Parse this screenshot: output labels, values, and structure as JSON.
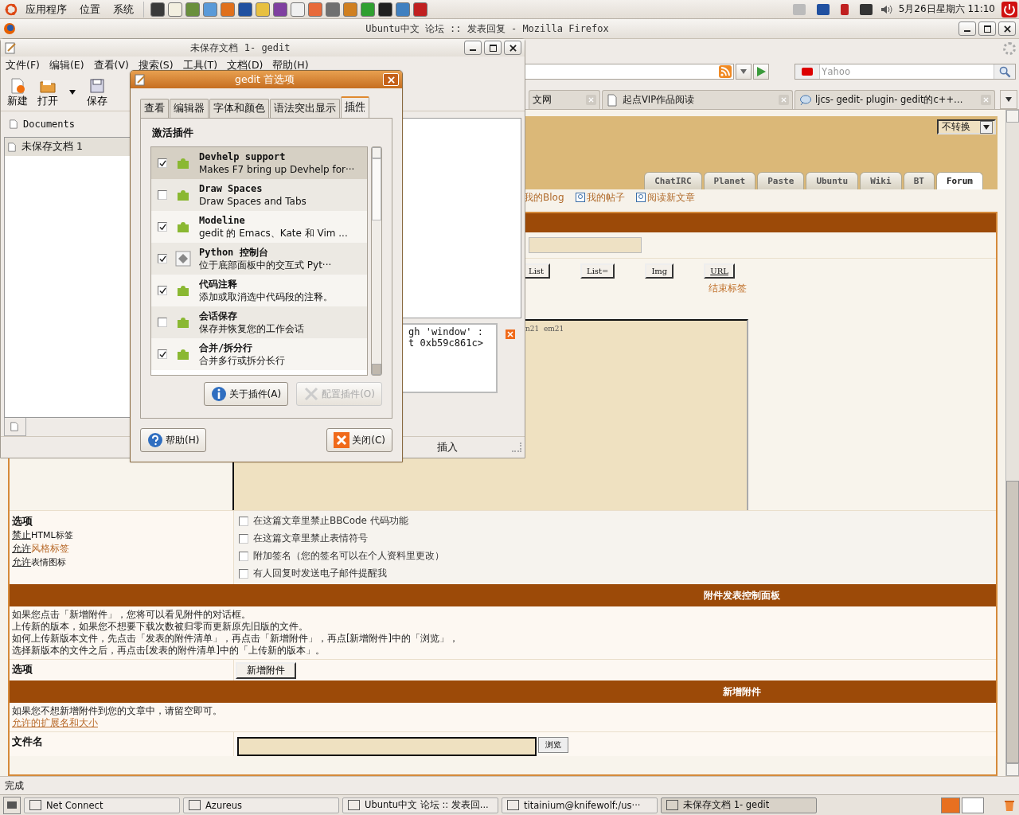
{
  "top_panel": {
    "menus": [
      "应用程序",
      "位置",
      "系统"
    ],
    "clock": "5月26日星期六 11:10"
  },
  "firefox": {
    "title": "Ubuntu中文 论坛 :: 发表回复 - Mozilla Firefox",
    "search": {
      "placeholder": "Yahoo"
    },
    "tabs": [
      {
        "label": "文网",
        "selected": false
      },
      {
        "label": "起点VIP作品阅读",
        "selected": false
      },
      {
        "label": "ljcs- gedit- plugin- gedit的c++…",
        "selected": false
      }
    ],
    "page": {
      "encoding_select": "不转换",
      "site_tabs": [
        {
          "label": "ChatIRC",
          "selected": false
        },
        {
          "label": "Planet",
          "selected": false
        },
        {
          "label": "Paste",
          "selected": false
        },
        {
          "label": "Ubuntu",
          "selected": false
        },
        {
          "label": "Wiki",
          "selected": false
        },
        {
          "label": "BT",
          "selected": false
        },
        {
          "label": "Forum",
          "selected": true
        }
      ],
      "user_links": [
        "我的Blog",
        "我的帖子",
        "阅读新文章"
      ],
      "bbcode_buttons": [
        "List",
        "List=",
        "Img",
        "URL"
      ],
      "close_tags_link": "结束标签",
      "message_text": "n21  em21",
      "options": {
        "heading": "选项",
        "rules": [
          {
            "state": "禁止",
            "rest": "HTML标签",
            "link": false
          },
          {
            "state": "允许",
            "rest": "风格标签",
            "link": true
          },
          {
            "state": "允许",
            "rest": "表情图标",
            "link": false
          }
        ],
        "checkboxes": [
          {
            "label": "在这篇文章里禁止BBCode 代码功能",
            "checked": false
          },
          {
            "label": "在这篇文章里禁止表情符号",
            "checked": false
          },
          {
            "label": "附加签名（您的签名可以在个人资料里更改）",
            "checked": false
          },
          {
            "label": "有人回复时发送电子邮件提醒我",
            "checked": false
          }
        ]
      },
      "attach_panel": {
        "title": "附件发表控制面板",
        "lines": [
          "如果您点击「新增附件」，您将可以看见附件的对话框。",
          "上传新的版本，如果您不想要下载次数被归零而更新原先旧版的文件。",
          "如何上传新版本文件，先点击「发表的附件清单」，再点击「新增附件」，再点[新增附件]中的「浏览」，",
          "选择新版本的文件之后，再点击[发表的附件清单]中的「上传新的版本」。"
        ],
        "option_label": "选项",
        "add_button": "新增附件"
      },
      "new_attach": {
        "title": "新增附件",
        "hint": "如果您不想新增附件到您的文章中，请留空即可。",
        "link": "允许的扩展名和大小",
        "file_label": "文件名",
        "browse": "浏览"
      }
    },
    "status": "完成"
  },
  "gedit": {
    "title": "未保存文档 1- gedit",
    "menus": [
      "文件(F)",
      "编辑(E)",
      "查看(V)",
      "搜索(S)",
      "工具(T)",
      "文档(D)",
      "帮助(H)"
    ],
    "toolbar": [
      {
        "label": "新建",
        "kind": "new"
      },
      {
        "label": "打开",
        "kind": "open"
      },
      {
        "label": "保存",
        "kind": "save"
      }
    ],
    "side_header": "Documents",
    "documents": [
      {
        "label": "未保存文档 1",
        "selected": true
      }
    ],
    "console_lines": [
      "gh 'window' :",
      "t 0xb59c861c>"
    ],
    "status": "插入"
  },
  "prefs": {
    "title": "gedit 首选项",
    "tabs": [
      {
        "label": "查看",
        "selected": false
      },
      {
        "label": "编辑器",
        "selected": false
      },
      {
        "label": "字体和颜色",
        "selected": false
      },
      {
        "label": "语法突出显示",
        "selected": false
      },
      {
        "label": "插件",
        "selected": true
      }
    ],
    "heading": "激活插件",
    "plugins": [
      {
        "name": "Devhelp support",
        "desc": "Makes F7 bring up Devhelp for···",
        "checked": true,
        "selected": true,
        "kind": "puzzle"
      },
      {
        "name": "Draw Spaces",
        "desc": "Draw Spaces and Tabs",
        "checked": false,
        "selected": false,
        "kind": "puzzle"
      },
      {
        "name": "Modeline",
        "desc": "gedit 的 Emacs、Kate 和 Vim ...",
        "checked": true,
        "selected": false,
        "kind": "puzzle"
      },
      {
        "name": "Python 控制台",
        "desc": "位于底部面板中的交互式 Pyt···",
        "checked": true,
        "selected": false,
        "kind": "python"
      },
      {
        "name": "代码注释",
        "desc": "添加或取消选中代码段的注释。",
        "checked": true,
        "selected": false,
        "kind": "puzzle"
      },
      {
        "name": "会话保存",
        "desc": "保存并恢复您的工作会话",
        "checked": false,
        "selected": false,
        "kind": "puzzle"
      },
      {
        "name": "合并/拆分行",
        "desc": "合并多行或拆分长行",
        "checked": true,
        "selected": false,
        "kind": "puzzle"
      }
    ],
    "buttons": [
      {
        "label": "关于插件(A)",
        "kind": "info",
        "disabled": false
      },
      {
        "label": "配置插件(O)",
        "kind": "tools",
        "disabled": true
      }
    ],
    "help": "帮助(H)",
    "close": "关闭(C)"
  },
  "taskbar": [
    {
      "label": "Net Connect",
      "selected": false
    },
    {
      "label": "Azureus",
      "selected": false
    },
    {
      "label": "Ubuntu中文 论坛 :: 发表回...",
      "selected": false
    },
    {
      "label": "titainium@knifewolf:/us···",
      "selected": false
    },
    {
      "label": "未保存文档 1- gedit",
      "selected": true
    }
  ]
}
